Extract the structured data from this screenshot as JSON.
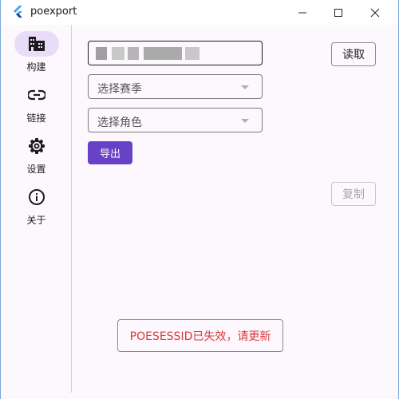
{
  "window": {
    "title": "poexport",
    "controls": {
      "minimize": "minimize-icon",
      "maximize": "maximize-icon",
      "close": "close-icon"
    }
  },
  "nav": {
    "items": [
      {
        "label": "构建",
        "icon": "building-icon",
        "active": true
      },
      {
        "label": "链接",
        "icon": "link-icon",
        "active": false
      },
      {
        "label": "设置",
        "icon": "gear-icon",
        "active": false
      },
      {
        "label": "关于",
        "icon": "info-icon",
        "active": false
      }
    ]
  },
  "form": {
    "sessid_value": "",
    "season_placeholder": "选择赛季",
    "character_placeholder": "选择角色",
    "read_label": "读取",
    "export_label": "导出",
    "copy_label": "复制"
  },
  "toast": {
    "message": "POESESSID已失效，请更新"
  },
  "colors": {
    "accent": "#6741c6",
    "nav_active_bg": "#e9dcf6",
    "error_text": "#d83a3a",
    "background": "#fdf8fd"
  }
}
